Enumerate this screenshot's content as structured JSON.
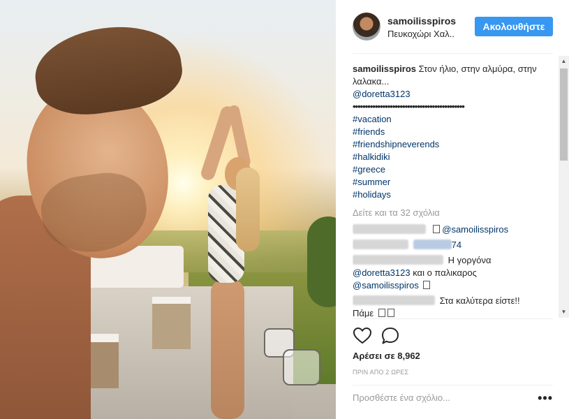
{
  "post": {
    "username": "samoilisspiros",
    "location": "Πευκοχώρι Χαλ..",
    "follow_label": "Ακολουθήστε"
  },
  "caption": {
    "username": "samoilisspiros",
    "text": "Στον ήλιο, στην αλμύρα, στην λαλακα...",
    "mention": "@doretta3123",
    "divider": "•••••••••••••••••••••••••••••••••••••••••••••",
    "hashtags": [
      "#vacation",
      "#friends",
      "#friendshipneverends",
      "#halkidiki",
      "#greece",
      "#summer",
      "#holidays"
    ]
  },
  "view_all": "Δείτε και τα 32 σχόλια",
  "comments": [
    {
      "text": "@samoilisspiros"
    },
    {
      "text": "74"
    },
    {
      "text": "Η γοργόνα",
      "mention": "@doretta3123",
      "after": "και ο παλικαρος",
      "mention2": "@samoilisspiros"
    },
    {
      "text": "Στα καλύτερα είστε!!",
      "next": "Πάμε"
    }
  ],
  "likes": "Αρέσει σε 8,962",
  "time": "ΠΡΙΝ ΑΠΟ 2 ΩΡΕΣ",
  "add_comment_placeholder": "Προσθέστε ένα σχόλιο...",
  "more_label": "•••",
  "icons": {
    "like": "heart-icon",
    "comment": "comment-icon",
    "more": "ellipsis-icon"
  },
  "colors": {
    "accent": "#3897f0",
    "link": "#003569",
    "muted": "#999999"
  }
}
